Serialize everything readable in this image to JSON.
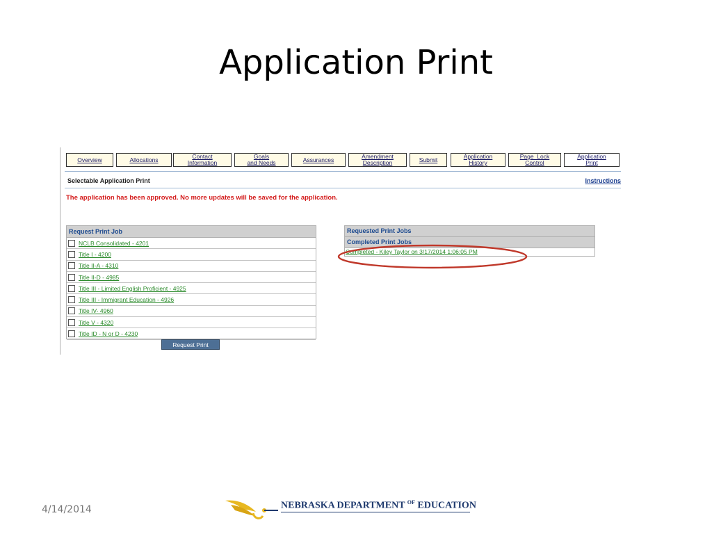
{
  "slide": {
    "title": "Application Print",
    "footer_date": "4/14/2014",
    "logo_text_1": "NEBRASKA DEPARTMENT",
    "logo_text_of": "OF",
    "logo_text_2": "EDUCATION"
  },
  "tabs": [
    {
      "line1": "Overview",
      "line2": ""
    },
    {
      "line1": "Allocations",
      "line2": ""
    },
    {
      "line1": "Contact",
      "line2": "Information"
    },
    {
      "line1": "Goals",
      "line2": "and Needs"
    },
    {
      "line1": "Assurances",
      "line2": ""
    },
    {
      "line1": "Amendment",
      "line2": "Description"
    },
    {
      "line1": "Submit",
      "line2": ""
    },
    {
      "line1": "Application",
      "line2": "History"
    },
    {
      "line1": "Page  Lock",
      "line2": "Control"
    },
    {
      "line1": "Application",
      "line2": "Print"
    }
  ],
  "section": {
    "title": "Selectable Application Print",
    "instructions": "Instructions",
    "alert": "The application has been approved. No more updates will be saved for the application."
  },
  "request_panel": {
    "header": "Request Print Job",
    "items": [
      "NCLB Consolidated - 4201",
      "Title I - 4200",
      "Title II-A - 4310",
      "Title II-D - 4985",
      "Title III - Limited English Proficient - 4925",
      "Title III - Immigrant Education - 4926",
      "Title IV- 4960",
      "Title V - 4320",
      "Title ID - N or D - 4230"
    ],
    "button": "Request Print"
  },
  "jobs_panel": {
    "header": "Requested Print Jobs",
    "subheader": "Completed Print Jobs",
    "job": "Completed - Kiley Taylor on 3/17/2014 1:06:05 PM"
  },
  "colors": {
    "alert": "#d41c1c",
    "link_green": "#2a8a2a",
    "header_blue": "#1d4a8f",
    "oval_red": "#c0392b",
    "logo_navy": "#1f3a6e",
    "logo_gold": "#e8b820"
  }
}
